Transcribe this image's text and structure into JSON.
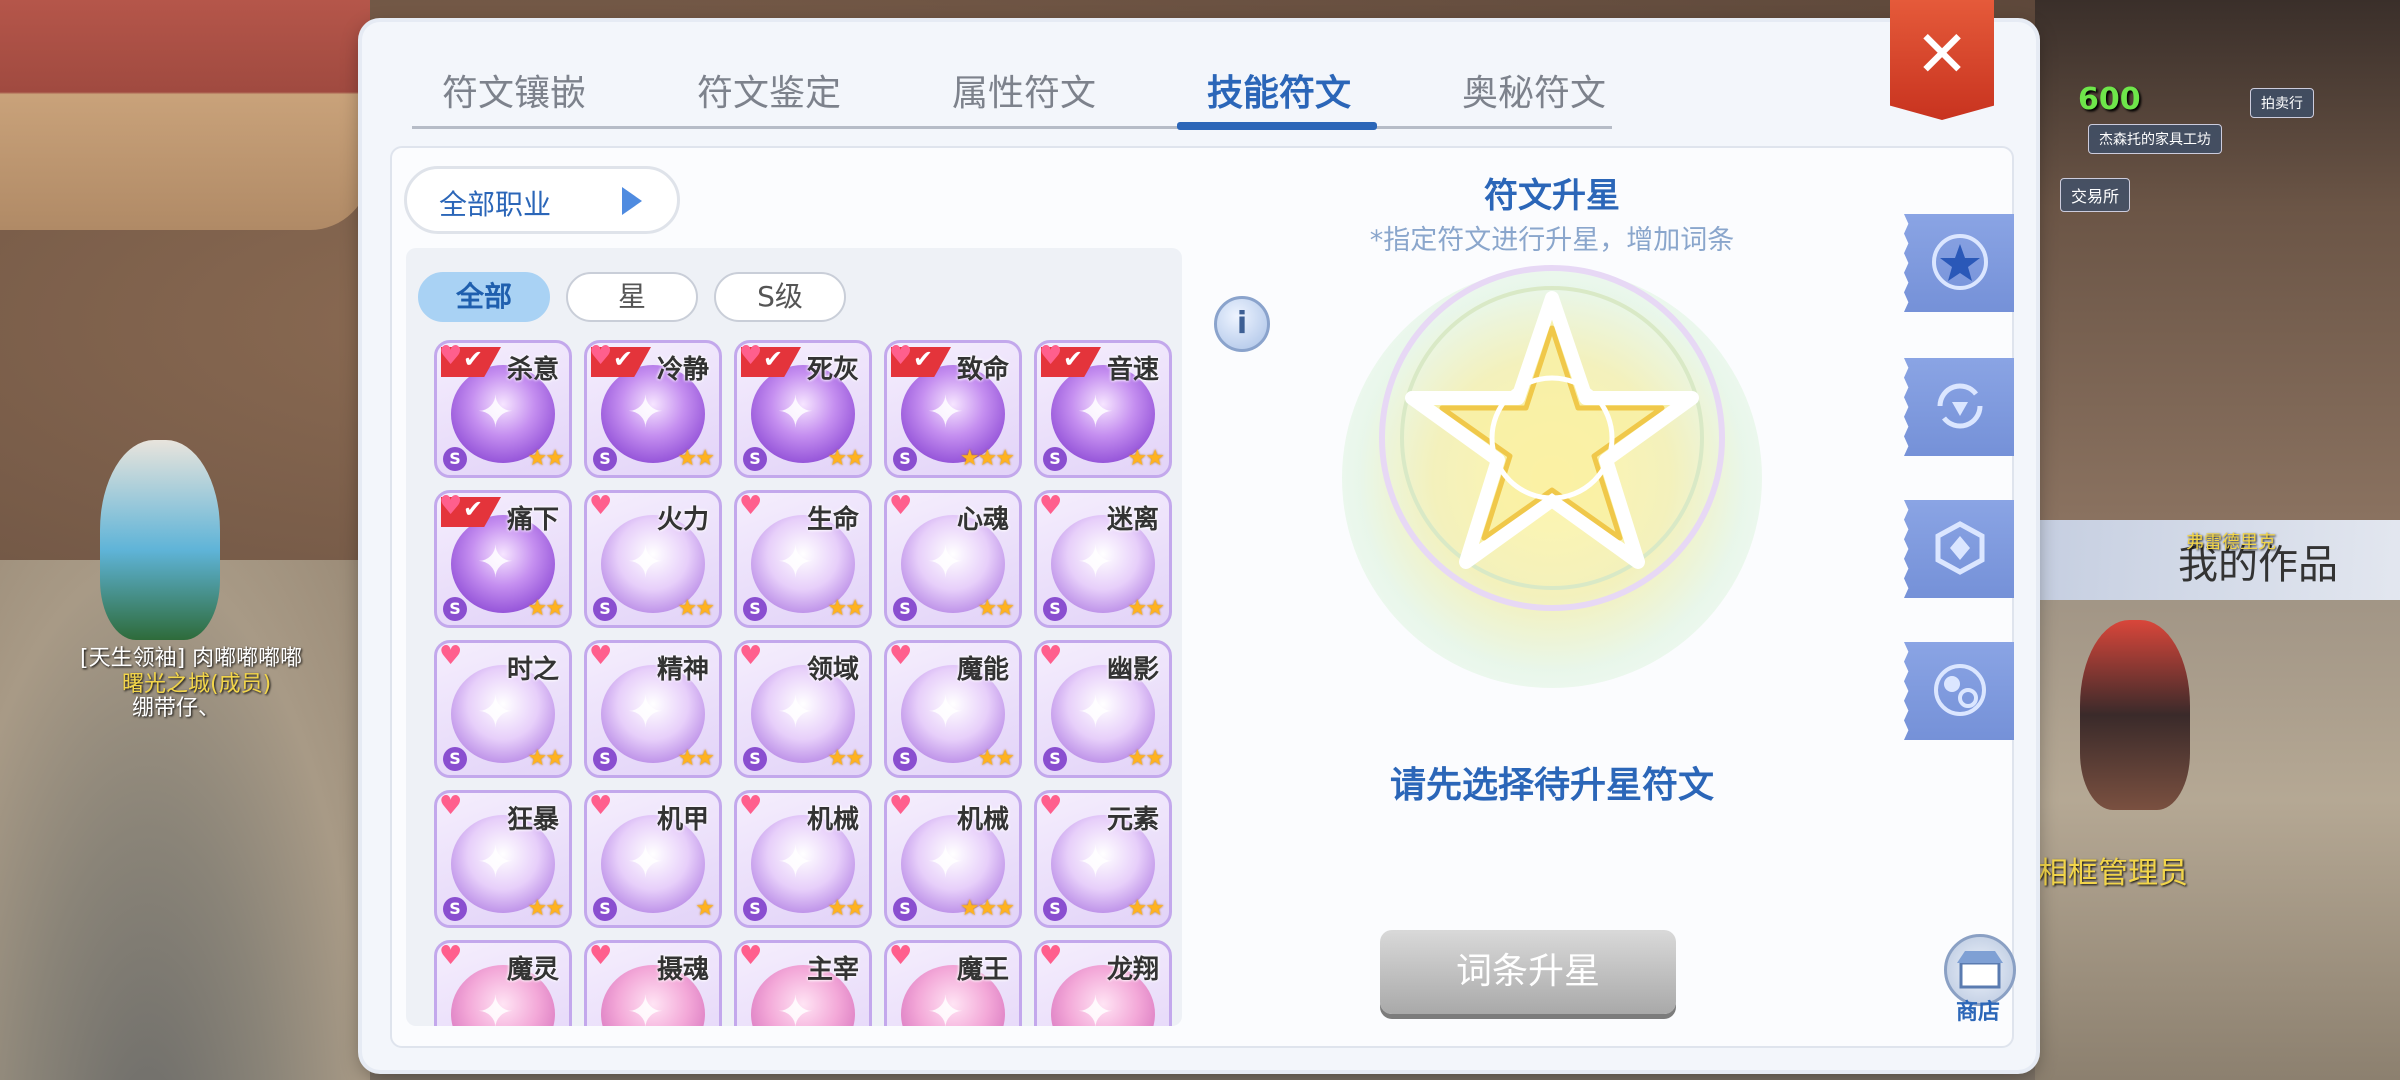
{
  "world": {
    "gold_counter": "600",
    "tag_furniture": "杰森托的家具工坊",
    "tag_exchange": "交易所",
    "tag_top": "拍卖行",
    "player_title": "[天生领袖] 肉嘟嘟嘟嘟",
    "player_guild": "曙光之城(成员)",
    "player_name": "绷带仔、",
    "my_works": "我的作品",
    "npc_name": "相框管理员",
    "npc_title": "弗雷德里克"
  },
  "tabs": [
    {
      "label": "符文镶嵌",
      "active": false
    },
    {
      "label": "符文鉴定",
      "active": false
    },
    {
      "label": "属性符文",
      "active": false
    },
    {
      "label": "技能符文",
      "active": true
    },
    {
      "label": "奥秘符文",
      "active": false
    }
  ],
  "close_icon": "✕",
  "job_filter": {
    "label": "全部职业"
  },
  "filters": [
    {
      "label": "全部",
      "active": true
    },
    {
      "label": "星",
      "active": false
    },
    {
      "label": "S级",
      "active": false
    }
  ],
  "runes": [
    {
      "name": "杀意",
      "grade": "S",
      "stars": "★★",
      "checked": true,
      "style": "purple"
    },
    {
      "name": "冷静",
      "grade": "S",
      "stars": "★★",
      "checked": true,
      "style": "purple"
    },
    {
      "name": "死灰",
      "grade": "S",
      "stars": "★★",
      "checked": true,
      "style": "purple"
    },
    {
      "name": "致命",
      "grade": "S",
      "stars": "★★★",
      "checked": true,
      "style": "purple"
    },
    {
      "name": "音速",
      "grade": "S",
      "stars": "★★",
      "checked": true,
      "style": "purple"
    },
    {
      "name": "痛下",
      "grade": "S",
      "stars": "★★",
      "checked": true,
      "style": "purple"
    },
    {
      "name": "火力",
      "grade": "S",
      "stars": "★★",
      "checked": false,
      "style": "light"
    },
    {
      "name": "生命",
      "grade": "S",
      "stars": "★★",
      "checked": false,
      "style": "light"
    },
    {
      "name": "心魂",
      "grade": "S",
      "stars": "★★",
      "checked": false,
      "style": "light"
    },
    {
      "name": "迷离",
      "grade": "S",
      "stars": "★★",
      "checked": false,
      "style": "light"
    },
    {
      "name": "时之",
      "grade": "S",
      "stars": "★★",
      "checked": false,
      "style": "light"
    },
    {
      "name": "精神",
      "grade": "S",
      "stars": "★★",
      "checked": false,
      "style": "light"
    },
    {
      "name": "领域",
      "grade": "S",
      "stars": "★★",
      "checked": false,
      "style": "light"
    },
    {
      "name": "魔能",
      "grade": "S",
      "stars": "★★",
      "checked": false,
      "style": "light"
    },
    {
      "name": "幽影",
      "grade": "S",
      "stars": "★★",
      "checked": false,
      "style": "light"
    },
    {
      "name": "狂暴",
      "grade": "S",
      "stars": "★★",
      "checked": false,
      "style": "light"
    },
    {
      "name": "机甲",
      "grade": "S",
      "stars": "★",
      "checked": false,
      "style": "light"
    },
    {
      "name": "机械",
      "grade": "S",
      "stars": "★★",
      "checked": false,
      "style": "light"
    },
    {
      "name": "机械",
      "grade": "S",
      "stars": "★★★",
      "checked": false,
      "style": "light"
    },
    {
      "name": "元素",
      "grade": "S",
      "stars": "★★",
      "checked": false,
      "style": "light"
    },
    {
      "name": "魔灵",
      "grade": "",
      "stars": "",
      "checked": false,
      "style": "pink"
    },
    {
      "name": "摄魂",
      "grade": "",
      "stars": "",
      "checked": false,
      "style": "pink"
    },
    {
      "name": "主宰",
      "grade": "",
      "stars": "",
      "checked": false,
      "style": "pink"
    },
    {
      "name": "魔王",
      "grade": "",
      "stars": "",
      "checked": false,
      "style": "pink"
    },
    {
      "name": "龙翔",
      "grade": "",
      "stars": "",
      "checked": false,
      "style": "pink"
    }
  ],
  "upgrade": {
    "title": "符文升星",
    "subtitle": "*指定符文进行升星，增加词条",
    "info_icon": "i",
    "hint": "请先选择待升星符文",
    "button": "词条升星"
  },
  "side_tabs": [
    {
      "icon": "star-rune-icon"
    },
    {
      "icon": "rune-refresh-icon"
    },
    {
      "icon": "rune-shield-icon"
    },
    {
      "icon": "rune-exchange-icon"
    }
  ],
  "shop": {
    "label": "商店"
  },
  "colors": {
    "accent": "#2b66b8",
    "close": "#d63a22",
    "side_tab": "#7d98dc"
  }
}
